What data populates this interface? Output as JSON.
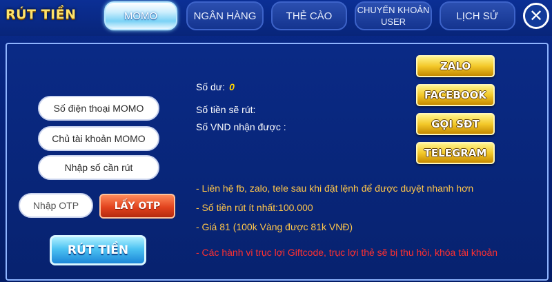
{
  "header": {
    "title": "RÚT TIỀN",
    "tabs": [
      {
        "label": "MOMO",
        "active": true
      },
      {
        "label": "NGÂN HÀNG",
        "active": false
      },
      {
        "label": "THẺ CÀO",
        "active": false
      },
      {
        "label": "CHUYỂN KHOẢN USER",
        "active": false
      },
      {
        "label": "LỊCH SỬ",
        "active": false
      }
    ],
    "close_icon": "close-icon"
  },
  "form": {
    "phone_placeholder": "Số điện thoại MOMO",
    "owner_placeholder": "Chủ tài khoản MOMO",
    "amount_placeholder": "Nhập số  cần rút",
    "otp_placeholder": "Nhập OTP",
    "get_otp_label": "LẤY OTP",
    "submit_label": "RÚT TIỀN"
  },
  "info": {
    "balance_label": "Số dư:",
    "balance_value": "0",
    "withdraw_label": "Số tiền sẽ rút:",
    "vnd_label": "Số VND nhận được :"
  },
  "contact": {
    "zalo": "ZALO",
    "facebook": "FACEBOOK",
    "phone": "GỌI SĐT",
    "telegram": "TELEGRAM"
  },
  "notes": [
    "- Liên hệ fb, zalo, tele sau khi đặt lệnh để được duyệt nhanh hơn",
    "- Số tiền rút ít nhất:100.000",
    "- Giá 81 (100k Vàng được 81k VNĐ)"
  ],
  "warning": "- Các hành vi trục lợi Giftcode, trục lợi thẻ sẽ bị thu hồi, khóa tài khoản",
  "colors": {
    "title_yellow": "#ffe36a",
    "note_orange": "#ffc64a",
    "warning_red": "#ff3030",
    "panel_border": "#8fb4ff"
  }
}
